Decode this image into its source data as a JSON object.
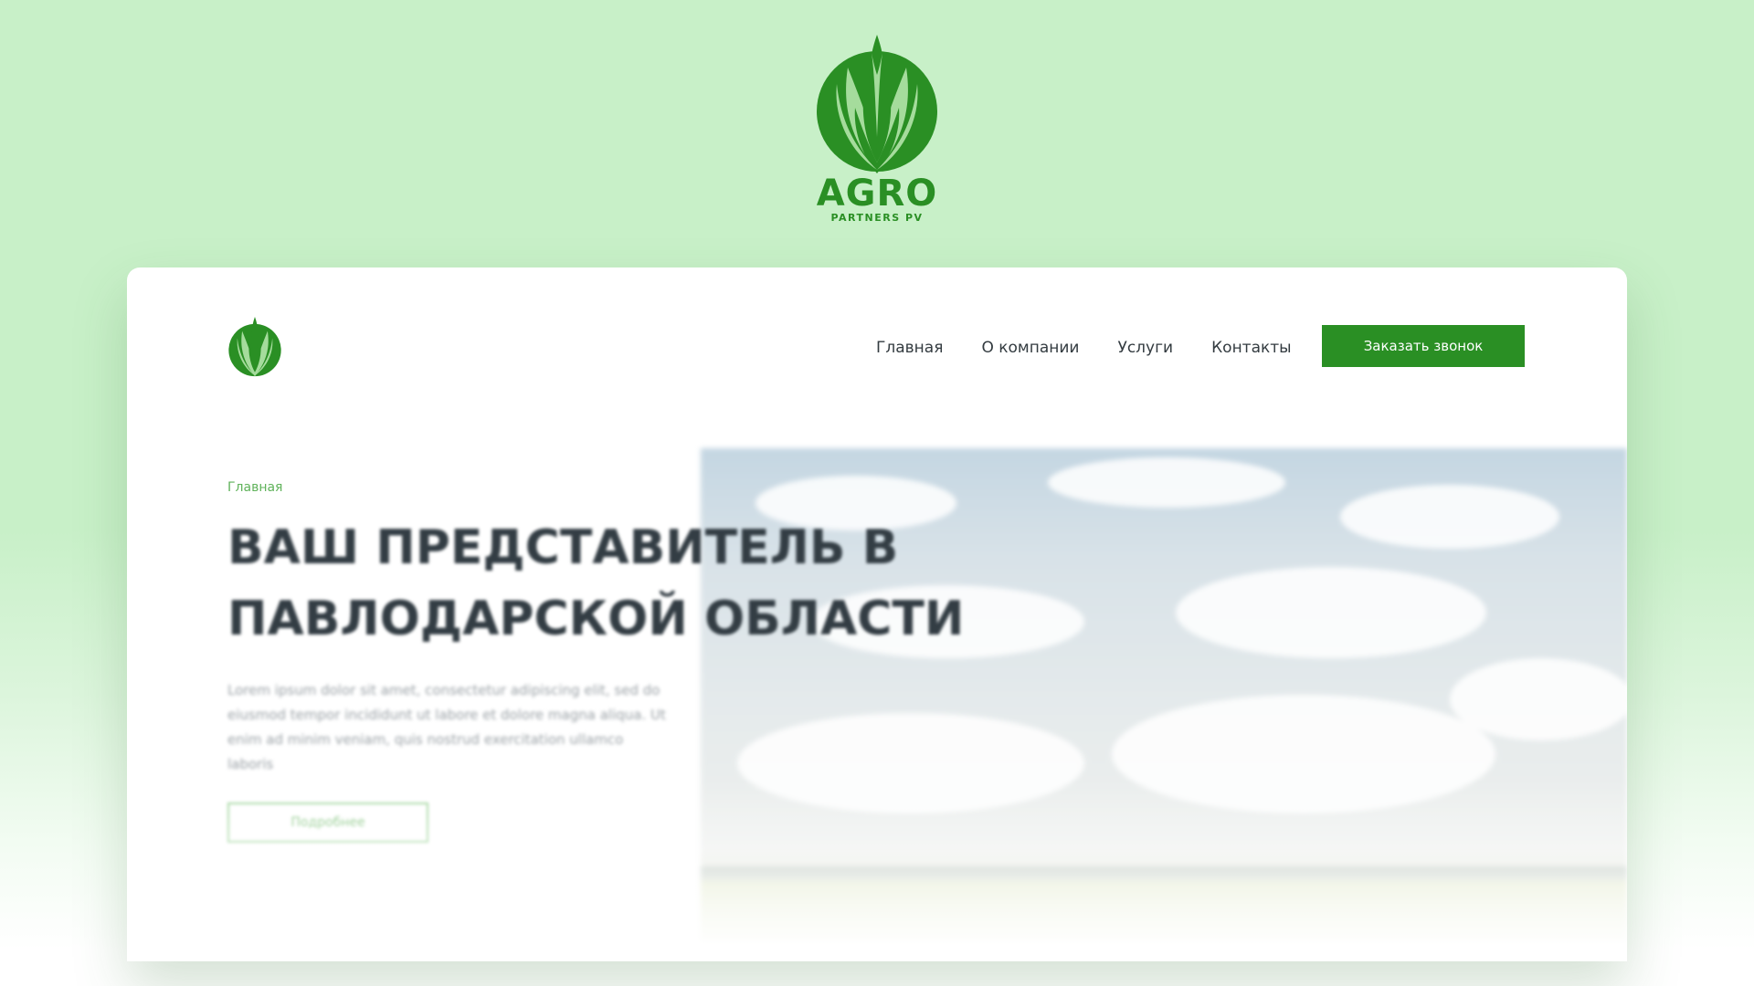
{
  "brand": {
    "name": "AGRO",
    "tagline": "PARTNERS PV",
    "icon": "leaf-emblem-icon"
  },
  "colors": {
    "page_background": "#c8f0c8",
    "brand_green": "#2a8f24",
    "nav_text": "#333b40",
    "breadcrumb_green": "#5fb25a",
    "title_text": "#333d44"
  },
  "site": {
    "logo_icon": "leaf-emblem-icon",
    "nav": [
      {
        "label": "Главная"
      },
      {
        "label": "О компании"
      },
      {
        "label": "Услуги"
      },
      {
        "label": "Контакты"
      }
    ],
    "cta_label": "Заказать звонок"
  },
  "hero": {
    "breadcrumb": "Главная",
    "title_line1": "ВАШ ПРЕДСТАВИТЕЛЬ В",
    "title_line2": "ПАВЛОДАРСКОЙ ОБЛАСТИ",
    "text": "Lorem ipsum dolor sit amet, consectetur adipiscing elit, sed do eiusmod tempor incididunt ut labore et dolore magna aliqua. Ut enim ad minim veniam, quis nostrud exercitation ullamco laboris",
    "button_label": "Подробнее",
    "image": "sky-and-field-photo"
  }
}
